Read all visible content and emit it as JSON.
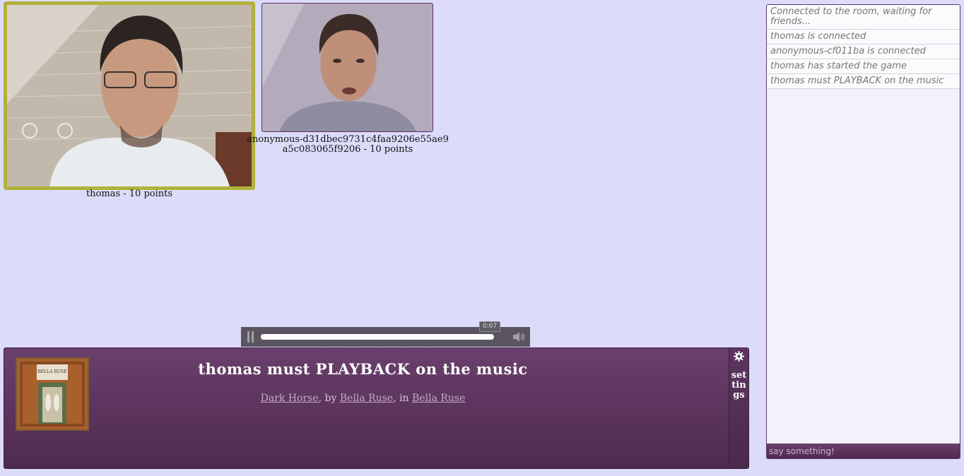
{
  "players": [
    {
      "name": "thomas",
      "points_label": "thomas - 10 points",
      "active": true
    },
    {
      "name": "anonymous-d31dbec9731c4faa9206e55ae9a5c083065f9206",
      "points_label": "anonymous-d31dbec9731c4faa9206e55ae9a5c083065f9206 - 10 points",
      "active": false
    }
  ],
  "player_bar": {
    "current_time": "0:07",
    "progress_fraction": 0.99
  },
  "game": {
    "headline": "thomas must PLAYBACK on the music",
    "track_title": "Dark Horse",
    "by_text": ", by ",
    "artist": "Bella Ruse",
    "in_text": ", in ",
    "album": "Bella Ruse",
    "album_art_text": "BELLA RUSE"
  },
  "settings": {
    "label": "settings"
  },
  "chat": {
    "messages": [
      "Connected to the room, waiting for friends...",
      "thomas is connected",
      "anonymous-cf011ba is connected",
      "thomas has started the game",
      "thomas must PLAYBACK on the music"
    ],
    "input_placeholder": "say something!"
  },
  "colors": {
    "page_background": "#dcdcfa",
    "active_border": "#b1b13b",
    "panel_purple": "#5d355f"
  }
}
